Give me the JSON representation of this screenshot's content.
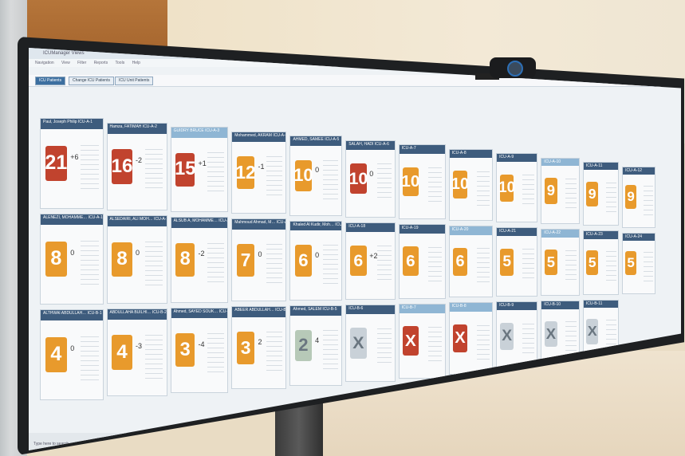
{
  "app": {
    "title": "ICUManager Views",
    "menu": [
      "Navigation",
      "View",
      "Filter",
      "Reports",
      "Tools",
      "Help"
    ]
  },
  "tabs": [
    {
      "label": "ICU Patients",
      "active": true
    },
    {
      "label": "Change ICU Patients",
      "active": false
    },
    {
      "label": "ICU Unit Patients",
      "active": false
    }
  ],
  "cards": [
    {
      "header": "Paul, Joseph Philip   ICU-A-1",
      "score": "21",
      "delta": "+6",
      "color": "#c1432e"
    },
    {
      "header": "Hamza, FATIMAH   ICU-A-2",
      "score": "16",
      "delta": "-2",
      "color": "#c1432e"
    },
    {
      "header": "GUIDRY BRUCE   ICU-A-3",
      "score": "15",
      "delta": "+1",
      "color": "#c1432e",
      "light": true
    },
    {
      "header": "Mohammed, AKRAM   ICU-A-4",
      "score": "12",
      "delta": "-1",
      "color": "#e89a2c"
    },
    {
      "header": "AHMED, SAMEE   ICU-A-5",
      "score": "10",
      "delta": "0",
      "color": "#e89a2c"
    },
    {
      "header": "SALAH, HADI   ICU-A-6",
      "score": "10",
      "delta": "0",
      "color": "#c1432e"
    },
    {
      "header": "ICU-A-7",
      "score": "10",
      "delta": "",
      "color": "#e89a2c"
    },
    {
      "header": "ICU-A-8",
      "score": "10",
      "delta": "",
      "color": "#e89a2c"
    },
    {
      "header": "ICU-A-9",
      "score": "10",
      "delta": "",
      "color": "#e89a2c"
    },
    {
      "header": "ICU-A-10",
      "score": "9",
      "delta": "",
      "color": "#e89a2c",
      "light": true
    },
    {
      "header": "ICU-A-11",
      "score": "9",
      "delta": "",
      "color": "#e89a2c"
    },
    {
      "header": "ICU-A-12",
      "score": "9",
      "delta": "",
      "color": "#e89a2c"
    },
    {
      "header": "ALENEZI, MOHAMME…   ICU-A-13",
      "score": "8",
      "delta": "0",
      "color": "#e89a2c"
    },
    {
      "header": "ALSEDAIRI, ALI MOH…   ICU-A-14",
      "score": "8",
      "delta": "0",
      "color": "#e89a2c"
    },
    {
      "header": "ALSUB A, MOHAMME…   ICU-A-15",
      "score": "8",
      "delta": "-2",
      "color": "#e89a2c"
    },
    {
      "header": "Mahmoud Ahmad, M…   ICU-A-16",
      "score": "7",
      "delta": "0",
      "color": "#e89a2c"
    },
    {
      "header": "Khaled Al Kudir, Moh…   ICU-A-17",
      "score": "6",
      "delta": "0",
      "color": "#e89a2c"
    },
    {
      "header": "ICU-A-18",
      "score": "6",
      "delta": "+2",
      "color": "#e89a2c"
    },
    {
      "header": "ICU-A-19",
      "score": "6",
      "delta": "",
      "color": "#e89a2c"
    },
    {
      "header": "ICU-A-20",
      "score": "6",
      "delta": "",
      "color": "#e89a2c",
      "light": true
    },
    {
      "header": "ICU-A-21",
      "score": "5",
      "delta": "",
      "color": "#e89a2c"
    },
    {
      "header": "ICU-A-22",
      "score": "5",
      "delta": "",
      "color": "#e89a2c",
      "light": true
    },
    {
      "header": "ICU-A-23",
      "score": "5",
      "delta": "",
      "color": "#e89a2c"
    },
    {
      "header": "ICU-A-24",
      "score": "5",
      "delta": "",
      "color": "#e89a2c"
    },
    {
      "header": "ALTHWAI ABDULLAH…   ICU-B-1",
      "score": "4",
      "delta": "0",
      "color": "#e89a2c"
    },
    {
      "header": "ABDULLAHA BUILHI…   ICU-B-2",
      "score": "4",
      "delta": "-3",
      "color": "#e89a2c"
    },
    {
      "header": "Ahmed, SAYED SOUK…   ICU-B-3",
      "score": "3",
      "delta": "-4",
      "color": "#e89a2c"
    },
    {
      "header": "ABEER ABDULLAH…   ICU-B-4",
      "score": "3",
      "delta": "2",
      "color": "#e89a2c"
    },
    {
      "header": "Ahmed, SALEM   ICU-B-5",
      "score": "2",
      "delta": "4",
      "color": "#b7c9b8"
    },
    {
      "header": "ICU-B-6",
      "score": "X",
      "delta": "",
      "color": "#c9d1d8"
    },
    {
      "header": "ICU-B-7",
      "score": "X",
      "delta": "",
      "color": "#c1432e",
      "light": true
    },
    {
      "header": "ICU-B-8",
      "score": "X",
      "delta": "",
      "color": "#c1432e",
      "light": true
    },
    {
      "header": "ICU-B-9",
      "score": "X",
      "delta": "",
      "color": "#c9d1d8"
    },
    {
      "header": "ICU-B-10",
      "score": "X",
      "delta": "",
      "color": "#c9d1d8"
    },
    {
      "header": "ICU-B-11",
      "score": "X",
      "delta": "",
      "color": "#c9d1d8"
    }
  ],
  "taskbar": {
    "search_placeholder": "Type here to search"
  }
}
